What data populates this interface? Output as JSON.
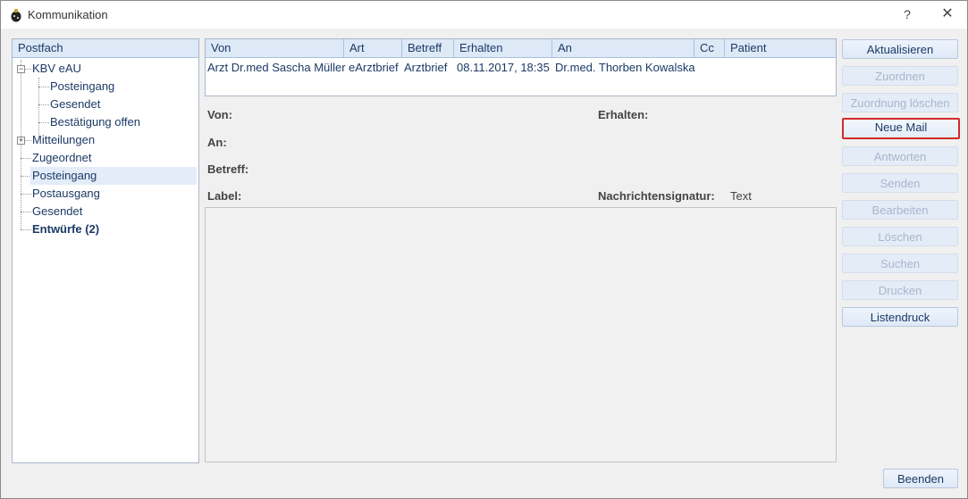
{
  "window": {
    "title": "Kommunikation",
    "help": "?",
    "close": "✕"
  },
  "tree": {
    "header": "Postfach",
    "items": [
      {
        "label": "KBV eAU"
      },
      {
        "label": "Posteingang"
      },
      {
        "label": "Gesendet"
      },
      {
        "label": "Bestätigung offen"
      },
      {
        "label": "Mitteilungen"
      },
      {
        "label": "Zugeordnet"
      },
      {
        "label": "Posteingang"
      },
      {
        "label": "Postausgang"
      },
      {
        "label": "Gesendet"
      },
      {
        "label": "Entwürfe (2)"
      }
    ],
    "expand_minus": "−",
    "expand_plus": "+"
  },
  "grid": {
    "columns": [
      "Von",
      "Art",
      "Betreff",
      "Erhalten",
      "An",
      "Cc",
      "Patient"
    ],
    "rows": [
      [
        "Arzt Dr.med Sascha Müller",
        "eArztbrief",
        "Arztbrief",
        "08.11.2017, 18:35",
        "Dr.med. Thorben Kowalska",
        "",
        ""
      ]
    ]
  },
  "detail": {
    "von_label": "Von:",
    "an_label": "An:",
    "betreff_label": "Betreff:",
    "label_label": "Label:",
    "erhalten_label": "Erhalten:",
    "signatur_label": "Nachrichtensignatur:",
    "signatur_value": "Text"
  },
  "buttons": {
    "aktualisieren": "Aktualisieren",
    "zuordnen": "Zuordnen",
    "zuordnung_loeschen": "Zuordnung löschen",
    "neue_mail": "Neue Mail",
    "antworten": "Antworten",
    "senden": "Senden",
    "bearbeiten": "Bearbeiten",
    "loeschen": "Löschen",
    "suchen": "Suchen",
    "drucken": "Drucken",
    "listendruck": "Listendruck",
    "beenden": "Beenden"
  },
  "colors": {
    "accent_text": "#1b3a66",
    "highlight_border": "#d22a2a",
    "header_bg": "#dde9f6"
  },
  "icons": {
    "app": "ladybug-app-icon",
    "help": "help-icon",
    "close": "close-icon"
  }
}
